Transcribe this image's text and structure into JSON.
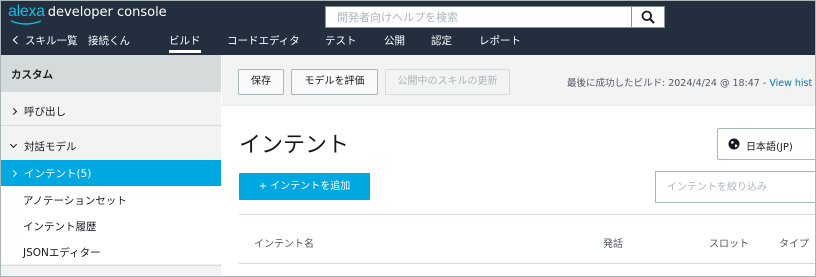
{
  "header": {
    "logo_brand": "alexa",
    "logo_product": "developer console",
    "search_placeholder": "開発者向けヘルプを検索",
    "search_icon": "search-icon"
  },
  "nav": {
    "back_label": "スキル一覧",
    "items": [
      "接続くん",
      "ビルド",
      "コードエディタ",
      "テスト",
      "公開",
      "認定",
      "レポート"
    ],
    "active": "ビルド"
  },
  "sidebar": {
    "heading": "カスタム",
    "sections": [
      "呼び出し",
      "対話モデル"
    ],
    "selected": "インテント(5)",
    "subitems": [
      "アノテーションセット",
      "インテント履歴",
      "JSONエディター"
    ]
  },
  "toolbar": {
    "save_label": "保存",
    "evaluate_label": "モデルを評価",
    "update_live_label": "公開中のスキルの更新",
    "last_build_text": "最後に成功したビルド: 2024/4/24 @ 18:47 - ",
    "history_link": "View hist"
  },
  "main": {
    "title": "インテント",
    "language": "日本語(JP)",
    "add_intent_label": "+ インテントを追加",
    "filter_placeholder": "インテントを絞り込み",
    "columns": [
      "インテント名",
      "発話",
      "スロット",
      "タイプ"
    ]
  },
  "colors": {
    "header_bg": "#232f3e",
    "accent": "#00a8e1",
    "logo_cyan": "#00c6e6"
  }
}
